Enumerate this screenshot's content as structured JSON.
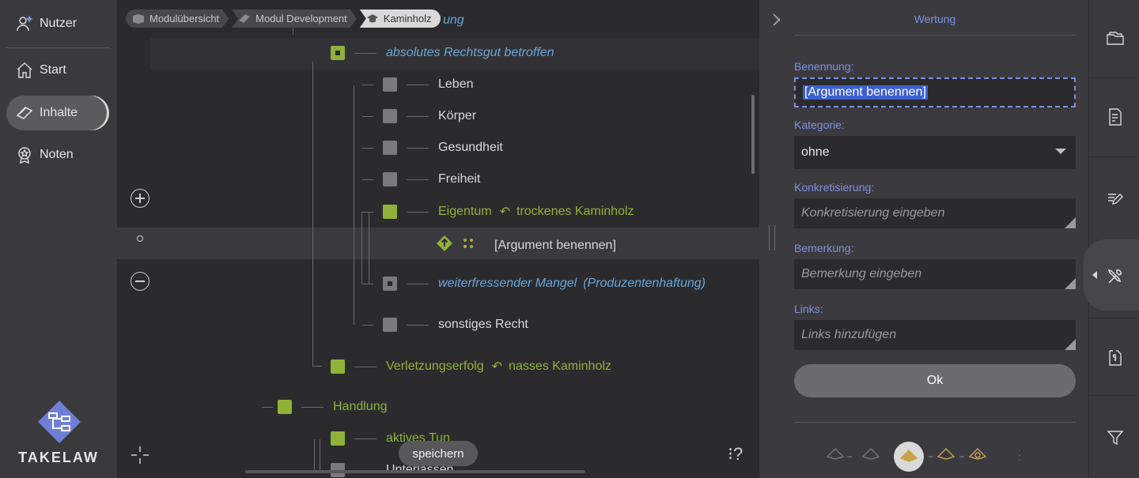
{
  "nav": {
    "user": "Nutzer",
    "start": "Start",
    "content": "Inhalte",
    "grades": "Noten",
    "logo_text": "TAKELAW"
  },
  "breadcrumb": [
    "Modulübersicht",
    "Modul Development",
    "Kaminholz"
  ],
  "tree": {
    "partial_top": "ung",
    "n1": "absolutes Rechtsgut betroffen",
    "n2": "Leben",
    "n3": "Körper",
    "n4": "Gesundheit",
    "n5": "Freiheit",
    "n6": "Eigentum",
    "n6_link": "trockenes Kaminholz",
    "n7": "[Argument benennen]",
    "n8": "weiterfressender Mangel",
    "n8_paren": "Produzentenhaftung",
    "n9": "sonstiges Recht",
    "n10": "Verletzungserfolg",
    "n10_link": "nasses Kaminholz",
    "n11": "Handlung",
    "n12": "aktives Tun",
    "n13": "Unterlassen"
  },
  "canvas": {
    "save": "speichern",
    "help": "⁝?"
  },
  "panel": {
    "title": "Wertung",
    "name_label": "Benennung:",
    "name_value": "[Argument benennen]",
    "category_label": "Kategorie:",
    "category_value": "ohne",
    "concrete_label": "Konkretisierung:",
    "concrete_placeholder": "Konkretisierung eingeben",
    "remark_label": "Bemerkung:",
    "remark_placeholder": "Bemerkung eingeben",
    "links_label": "Links:",
    "links_placeholder": "Links hinzufügen",
    "ok": "Ok"
  },
  "colors": {
    "accent": "#7e8fe0",
    "green": "#8fb239",
    "blue_label": "#6aa6d8",
    "gold": "#c9a24a"
  }
}
